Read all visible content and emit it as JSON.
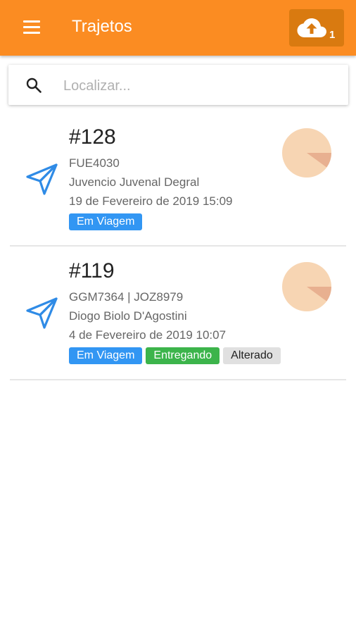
{
  "appbar": {
    "title": "Trajetos",
    "menu_icon": "hamburger-menu-icon",
    "sync_icon": "cloud-upload-icon",
    "sync_count": "1",
    "color": "#fb8c22"
  },
  "search": {
    "placeholder": "Localizar...",
    "value": "",
    "icon": "search-icon"
  },
  "trips": [
    {
      "id": "#128",
      "plates": "FUE4030",
      "driver": "Juvencio Juvenal Degral",
      "datetime": "19 de Fevereiro de 2019 15:09",
      "icon": "paper-plane-icon",
      "badges": [
        {
          "label": "Em Viagem",
          "color": "#3296f3"
        }
      ],
      "progress_fraction": 0.1
    },
    {
      "id": "#119",
      "plates": "GGM7364 | JOZ8979",
      "driver": "Diogo Biolo D'Agostini",
      "datetime": "4 de Fevereiro de 2019 10:07",
      "icon": "paper-plane-icon",
      "badges": [
        {
          "label": "Em Viagem",
          "color": "#3296f3"
        },
        {
          "label": "Entregando",
          "color": "#3cb44b"
        },
        {
          "label": "Alterado",
          "color": "#e0e0e0"
        }
      ],
      "progress_fraction": 0.1
    }
  ],
  "colors": {
    "accent": "#fb8c22",
    "icon_blue": "#2f8be6",
    "pie_bg": "#f7d5b3",
    "pie_slice": "#e8b090"
  }
}
